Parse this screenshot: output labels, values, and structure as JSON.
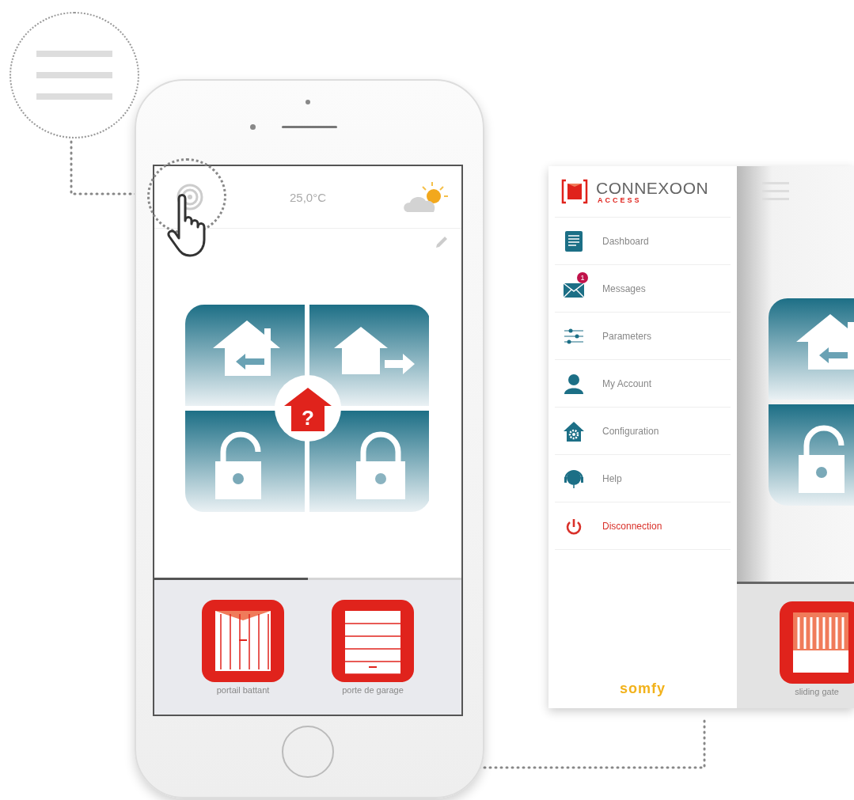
{
  "phone": {
    "temperature": "25,0°C",
    "status_symbol": "?",
    "devices": [
      {
        "label": "portail battant",
        "kind": "swing-gate"
      },
      {
        "label": "porte de garage",
        "kind": "garage-door"
      }
    ]
  },
  "menu": {
    "logo": {
      "name": "CONNEXOON",
      "subtitle": "ACCESS"
    },
    "items": [
      {
        "label": "Dashboard",
        "kind": "dashboard"
      },
      {
        "label": "Messages",
        "kind": "messages",
        "badge": "1"
      },
      {
        "label": "Parameters",
        "kind": "parameters"
      },
      {
        "label": "My Account",
        "kind": "account"
      },
      {
        "label": "Configuration",
        "kind": "configuration"
      },
      {
        "label": "Help",
        "kind": "help"
      },
      {
        "label": "Disconnection",
        "kind": "logout"
      }
    ],
    "brand": "somfy"
  },
  "background_screen": {
    "devices": [
      {
        "label": "sliding gate",
        "kind": "sliding-gate"
      }
    ]
  }
}
